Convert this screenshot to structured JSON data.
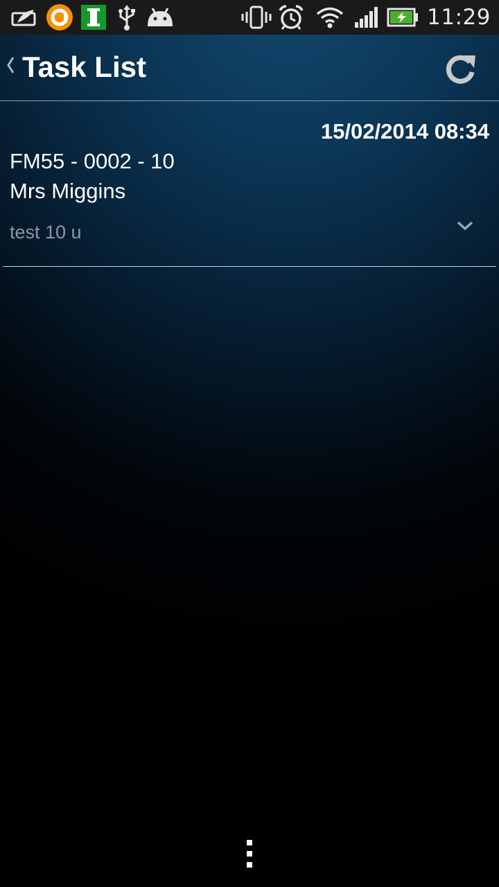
{
  "status_bar": {
    "time": "11:29",
    "left_icons": [
      "postcard-icon",
      "orange-app-icon",
      "green-i-icon",
      "usb-icon",
      "android-icon"
    ],
    "right_icons": [
      "vibrate-icon",
      "alarm-icon",
      "wifi-icon",
      "signal-icon",
      "battery-charging-icon"
    ]
  },
  "action_bar": {
    "title": "Task List",
    "back_icon": "back-caret-icon",
    "refresh_icon": "refresh-icon"
  },
  "tasks": [
    {
      "date": "15/02/2014 08:34",
      "code": "FM55 - 0002 - 10",
      "name": "Mrs Miggins",
      "note": "test 10 u"
    }
  ],
  "colors": {
    "accent_orange": "#f39200",
    "green_badge": "#159a2c",
    "battery_green": "#4caf2a"
  }
}
